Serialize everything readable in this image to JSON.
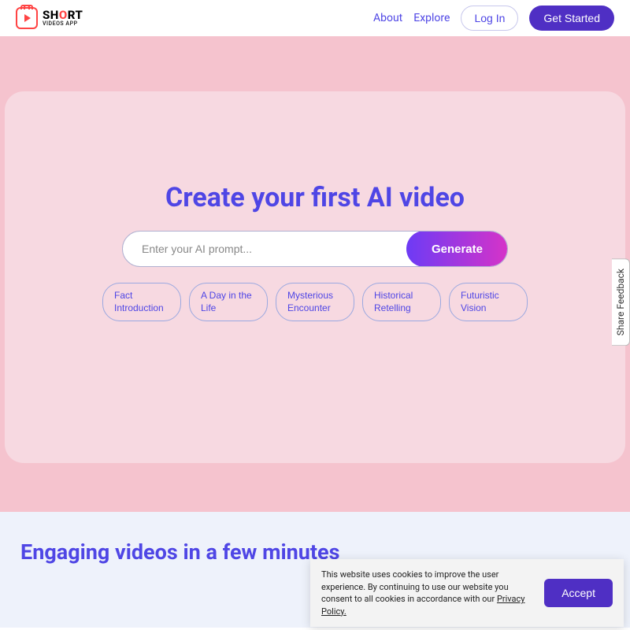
{
  "brand": {
    "name_pre": "SH",
    "name_o": "O",
    "name_post": "RT",
    "tagline": "VIDEOS APP"
  },
  "nav": {
    "about": "About",
    "explore": "Explore",
    "login": "Log In",
    "getstarted": "Get Started"
  },
  "hero": {
    "title": "Create your first AI video",
    "placeholder": "Enter your AI prompt...",
    "generate": "Generate",
    "chips": [
      "Fact Introduction",
      "A Day in the Life",
      "Mysterious Encounter",
      "Historical Retelling",
      "Futuristic Vision"
    ]
  },
  "section2": {
    "title": "Engaging videos in a few minutes"
  },
  "feedback": {
    "label": "Share Feedback"
  },
  "cookie": {
    "text_pre": "This website uses cookies to improve the user experience. By continuing to use our website you consent to all cookies in accordance with our ",
    "link": "Privacy Policy.",
    "accept": "Accept"
  },
  "colors": {
    "accent": "#4f46e5",
    "primary_btn": "#4f2fc4",
    "hero_bg": "#f5c3ce",
    "hero_card": "#f7d9e1"
  }
}
